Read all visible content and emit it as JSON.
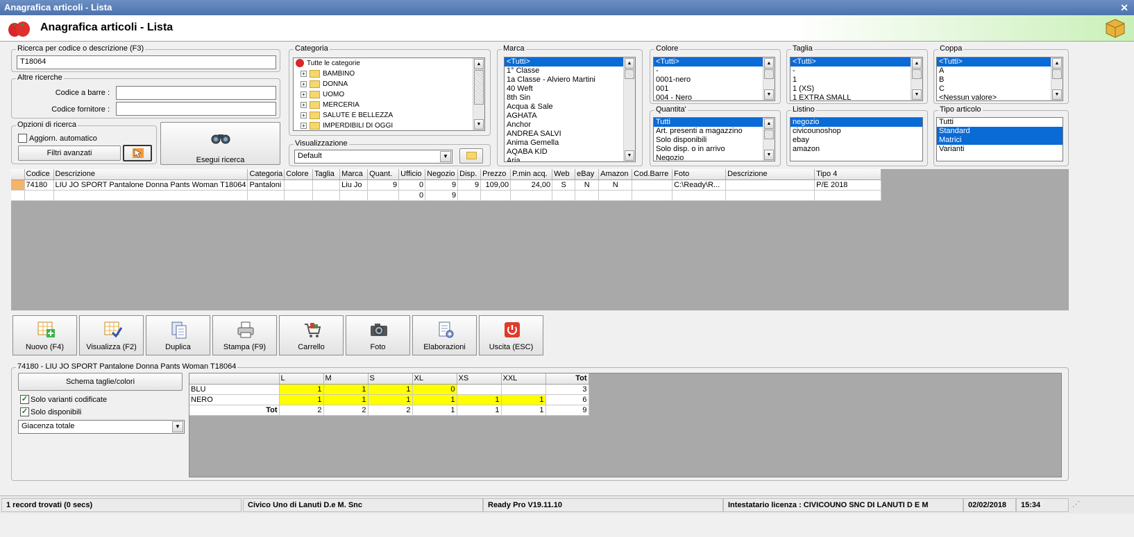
{
  "window": {
    "title": "Anagrafica articoli  - Lista",
    "close": "✕",
    "header_title": "Anagrafica articoli  - Lista"
  },
  "search": {
    "label": "Ricerca per codice o descrizione (F3)",
    "value": "T18064"
  },
  "other": {
    "label": "Altre ricerche",
    "barcode_label": "Codice a barre :",
    "barcode_value": "",
    "supplier_label": "Codice fornitore :",
    "supplier_value": ""
  },
  "options": {
    "label": "Opzioni di ricerca",
    "auto_update": "Aggiorn. automatico",
    "auto_update_checked": false,
    "advanced_filters": "Filtri avanzati",
    "execute": "Esegui ricerca"
  },
  "category": {
    "label": "Categoria",
    "root": "Tutte le categorie",
    "items": [
      "BAMBINO",
      "DONNA",
      "UOMO",
      "MERCERIA",
      "SALUTE E BELLEZZA",
      "IMPERDIBILI DI OGGI"
    ]
  },
  "view": {
    "label": "Visualizzazione",
    "value": "Default"
  },
  "brand": {
    "label": "Marca",
    "items": [
      "<Tutti>",
      "1° Classe",
      "1a Classe - Alviero Martini",
      "40 Weft",
      "8th Sin",
      "Acqua & Sale",
      "AGHATA",
      "Anchor",
      "ANDREA SALVI",
      "Anima Gemella",
      "AQABA KID",
      "Aria"
    ],
    "selected": 0
  },
  "color": {
    "label": "Colore",
    "items": [
      "<Tutti>",
      "-",
      "0001-nero",
      "001",
      "004 - Nero"
    ],
    "selected": 0
  },
  "size": {
    "label": "Taglia",
    "items": [
      "<Tutti>",
      "-",
      "1",
      "1 (XS)",
      "1 EXTRA SMALL"
    ],
    "selected": 0
  },
  "cup": {
    "label": "Coppa",
    "items": [
      "<Tutti>",
      "A",
      "B",
      "C",
      "<Nessun valore>"
    ],
    "selected": 0
  },
  "quantity": {
    "label": "Quantita'",
    "items": [
      "Tutti",
      "Art. presenti a magazzino",
      "Solo disponibili",
      "Solo disp. o in arrivo",
      "Negozio"
    ],
    "selected": 0
  },
  "pricelist": {
    "label": "Listino",
    "items": [
      "negozio",
      "civicounoshop",
      "ebay",
      "amazon"
    ],
    "selected": 0
  },
  "article_type": {
    "label": "Tipo articolo",
    "items": [
      "Tutti",
      "Standard",
      "Matrici",
      "Varianti"
    ],
    "selected": [
      1,
      2
    ]
  },
  "grid": {
    "headers": [
      "Codice",
      "Descrizione",
      "Categoria",
      "Colore",
      "Taglia",
      "Marca",
      "Quant.",
      "Ufficio",
      "Negozio",
      "Disp.",
      "Prezzo",
      "P.min acq.",
      "Web",
      "eBay",
      "Amazon",
      "Cod.Barre",
      "Foto",
      "Descrizione",
      "Tipo 4"
    ],
    "rows": [
      [
        "74180",
        "LIU JO SPORT Pantalone Donna Pants Woman T18064",
        "Pantaloni",
        "",
        "",
        "Liu Jo",
        "9",
        "0",
        "9",
        "9",
        "109,00",
        "24,00",
        "S",
        "N",
        "N",
        "",
        "C:\\Ready\\R...",
        "",
        "P/E 2018"
      ],
      [
        "",
        "",
        "",
        "",
        "",
        "",
        "",
        "0",
        "9",
        "",
        "",
        "",
        "",
        "",
        "",
        "",
        "",
        "",
        ""
      ]
    ]
  },
  "actions": {
    "new": "Nuovo (F4)",
    "view": "Visualizza (F2)",
    "duplicate": "Duplica",
    "print": "Stampa (F9)",
    "cart": "Carrello",
    "photo": "Foto",
    "processing": "Elaborazioni",
    "exit": "Uscita (ESC)"
  },
  "detail": {
    "label": "74180 - LIU JO SPORT Pantalone Donna Pants Woman T18064",
    "schema_button": "Schema taglie/colori",
    "only_coded": "Solo varianti codificate",
    "only_coded_checked": true,
    "only_available": "Solo disponibili",
    "only_available_checked": true,
    "stock_mode": "Giacenza totale",
    "matrix": {
      "sizes": [
        "L",
        "M",
        "S",
        "XL",
        "XS",
        "XXL"
      ],
      "total_label": "Tot",
      "rows": [
        {
          "color": "BLU",
          "values": [
            "1",
            "1",
            "1",
            "0",
            "",
            ""
          ],
          "total": "3"
        },
        {
          "color": "NERO",
          "values": [
            "1",
            "1",
            "1",
            "1",
            "1",
            "1"
          ],
          "total": "6"
        }
      ],
      "totals": [
        "2",
        "2",
        "2",
        "1",
        "1",
        "1"
      ],
      "grand_total": "9"
    }
  },
  "status": {
    "records": "1 record trovati (0 secs)",
    "company": "Civico Uno di Lanuti D.e M. Snc",
    "version": "Ready Pro V19.11.10",
    "license": "Intestatario licenza : CIVICOUNO SNC DI LANUTI D E M",
    "date": "02/02/2018",
    "time": "15:34"
  },
  "colors": {
    "selection": "#0a6ad6",
    "highlight": "#ffff00",
    "row_marker": "#f5b469"
  }
}
